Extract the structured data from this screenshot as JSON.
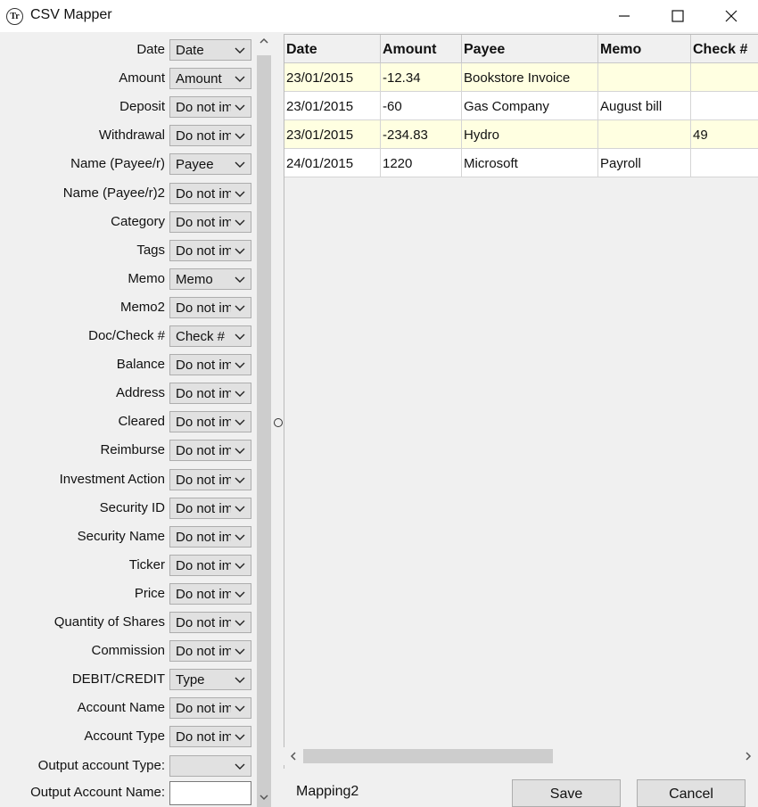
{
  "window": {
    "title": "CSV Mapper",
    "icon_text": "Tr"
  },
  "mappings": [
    {
      "label": "Date",
      "value": "Date"
    },
    {
      "label": "Amount",
      "value": "Amount"
    },
    {
      "label": "Deposit",
      "value": "Do not import"
    },
    {
      "label": "Withdrawal",
      "value": "Do not import"
    },
    {
      "label": "Name (Payee/r)",
      "value": "Payee"
    },
    {
      "label": "Name (Payee/r)2",
      "value": "Do not import"
    },
    {
      "label": "Category",
      "value": "Do not import"
    },
    {
      "label": "Tags",
      "value": "Do not import"
    },
    {
      "label": "Memo",
      "value": "Memo"
    },
    {
      "label": "Memo2",
      "value": "Do not import"
    },
    {
      "label": "Doc/Check #",
      "value": "Check #"
    },
    {
      "label": "Balance",
      "value": "Do not import"
    },
    {
      "label": "Address",
      "value": "Do not import"
    },
    {
      "label": "Cleared",
      "value": "Do not import"
    },
    {
      "label": "Reimburse",
      "value": "Do not import"
    },
    {
      "label": "Investment Action",
      "value": "Do not import"
    },
    {
      "label": "Security ID",
      "value": "Do not import"
    },
    {
      "label": "Security Name",
      "value": "Do not import"
    },
    {
      "label": "Ticker",
      "value": "Do not import"
    },
    {
      "label": "Price",
      "value": "Do not import"
    },
    {
      "label": "Quantity of Shares",
      "value": "Do not import"
    },
    {
      "label": "Commission",
      "value": "Do not import"
    },
    {
      "label": "DEBIT/CREDIT",
      "value": "Type"
    },
    {
      "label": "Account Name",
      "value": "Do not import"
    },
    {
      "label": "Account Type",
      "value": "Do not import"
    },
    {
      "label": "Output account Type:",
      "value": ""
    }
  ],
  "output_account_name": {
    "label": "Output Account Name:",
    "value": ""
  },
  "grid": {
    "columns": [
      "Date",
      "Amount",
      "Payee",
      "Memo",
      "Check #"
    ],
    "rows": [
      [
        "23/01/2015",
        "-12.34",
        "Bookstore Invoice",
        "",
        ""
      ],
      [
        "23/01/2015",
        "-60",
        "Gas Company",
        "August bill",
        ""
      ],
      [
        "23/01/2015",
        "-234.83",
        "Hydro",
        "",
        "49"
      ],
      [
        "24/01/2015",
        "1220",
        "Microsoft",
        "Payroll",
        ""
      ]
    ],
    "row_colors": {
      "alt": "#ffffe1",
      "normal": "#ffffff"
    }
  },
  "footer": {
    "mapping_name": "Mapping2",
    "save_label": "Save",
    "cancel_label": "Cancel"
  }
}
